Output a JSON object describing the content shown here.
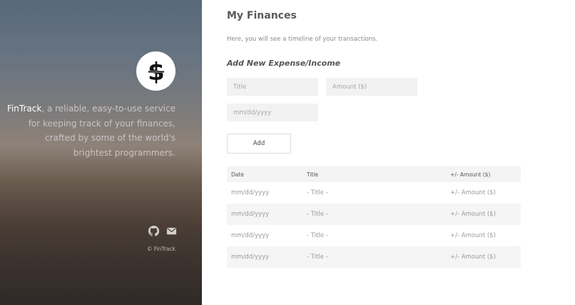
{
  "sidebar": {
    "brand": "FinTrack",
    "tagline": ", a reliable, easy-to-use service for keeping track of your finances, crafted by some of the world's brightest programmers.",
    "icons": [
      "dollar-logo-icon",
      "github-icon",
      "mail-icon"
    ],
    "copyright": "© FinTrack"
  },
  "main": {
    "title": "My Finances",
    "subtitle": "Here, you will see a timeline of your transactions.",
    "form": {
      "heading": "Add New Expense/Income",
      "title_placeholder": "Title",
      "amount_placeholder": "Amount ($)",
      "date_placeholder": "mm/dd/yyyy",
      "add_label": "Add"
    },
    "table": {
      "headers": [
        "Date",
        "Title",
        "+/- Amount ($)"
      ],
      "rows": [
        [
          "mm/dd/yyyy",
          "- Title -",
          "+/- Amount ($)"
        ],
        [
          "mm/dd/yyyy",
          "- Title -",
          "+/- Amount ($)"
        ],
        [
          "mm/dd/yyyy",
          "- Title -",
          "+/- Amount ($)"
        ],
        [
          "mm/dd/yyyy",
          "- Title -",
          "+/- Amount ($)"
        ]
      ]
    }
  },
  "colors": {
    "sidebar_top": "#58697a",
    "sidebar_bottom": "#2f2a28",
    "input_bg": "#f2f2f2",
    "row_alt": "#f5f5f5"
  }
}
